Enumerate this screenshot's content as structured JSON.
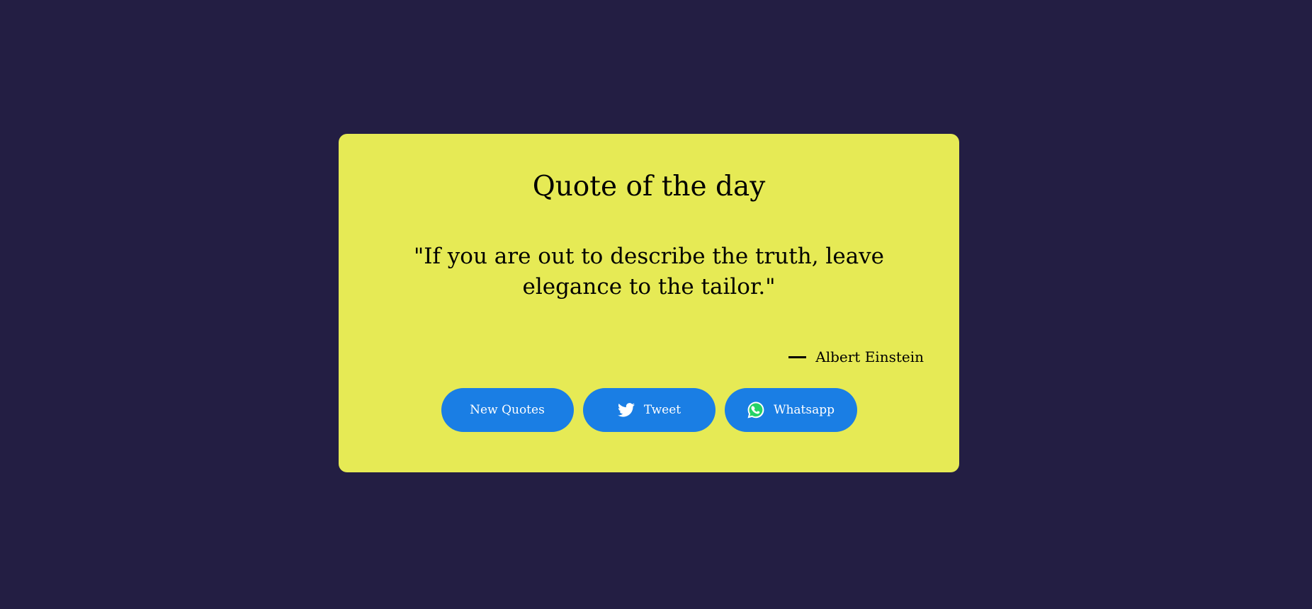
{
  "card": {
    "title": "Quote of the day",
    "quote": "\"If you are out to describe the truth, leave elegance to the tailor.\"",
    "author": "Albert Einstein"
  },
  "buttons": {
    "new_quotes": "New Quotes",
    "tweet": "Tweet",
    "whatsapp": "Whatsapp"
  },
  "icons": {
    "tweet": "twitter-icon",
    "whatsapp": "whatsapp-icon"
  },
  "colors": {
    "background": "#231e43",
    "card": "#e6ea55",
    "button": "#1a7ee4",
    "whatsapp_green": "#25d366"
  }
}
